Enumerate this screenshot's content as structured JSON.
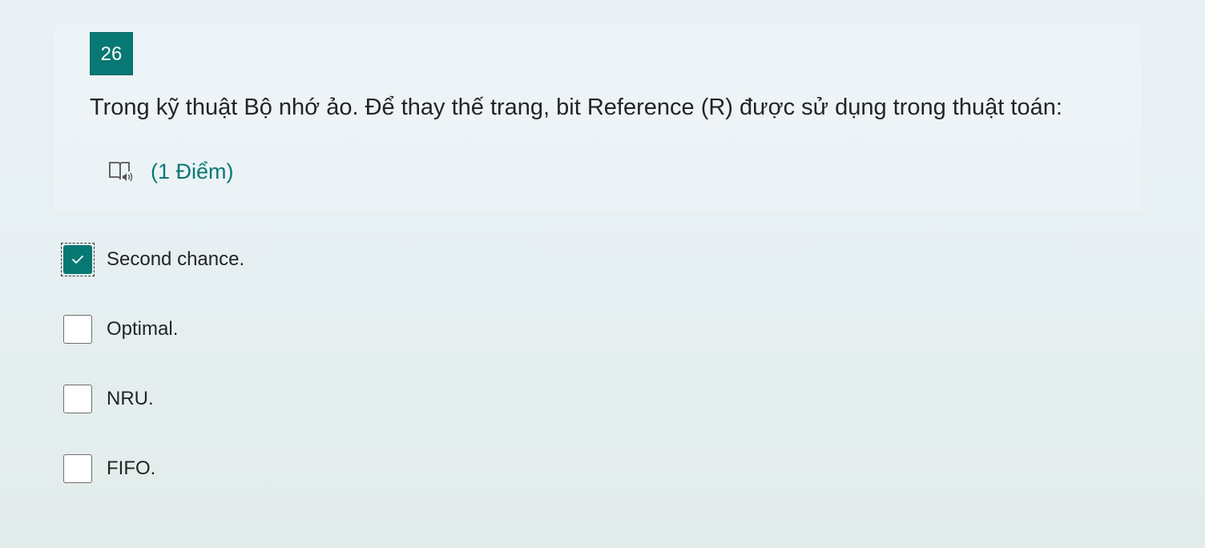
{
  "question": {
    "number": "26",
    "text": "Trong kỹ thuật Bộ nhớ ảo. Để thay thế trang, bit Reference (R) được sử dụng trong thuật toán:",
    "points": "(1 Điểm)",
    "reader_icon": "immersive-reader-icon"
  },
  "options": [
    {
      "label": "Second chance.",
      "checked": true
    },
    {
      "label": "Optimal.",
      "checked": false
    },
    {
      "label": "NRU.",
      "checked": false
    },
    {
      "label": "FIFO.",
      "checked": false
    }
  ],
  "colors": {
    "accent": "#077873",
    "text": "#242424"
  }
}
